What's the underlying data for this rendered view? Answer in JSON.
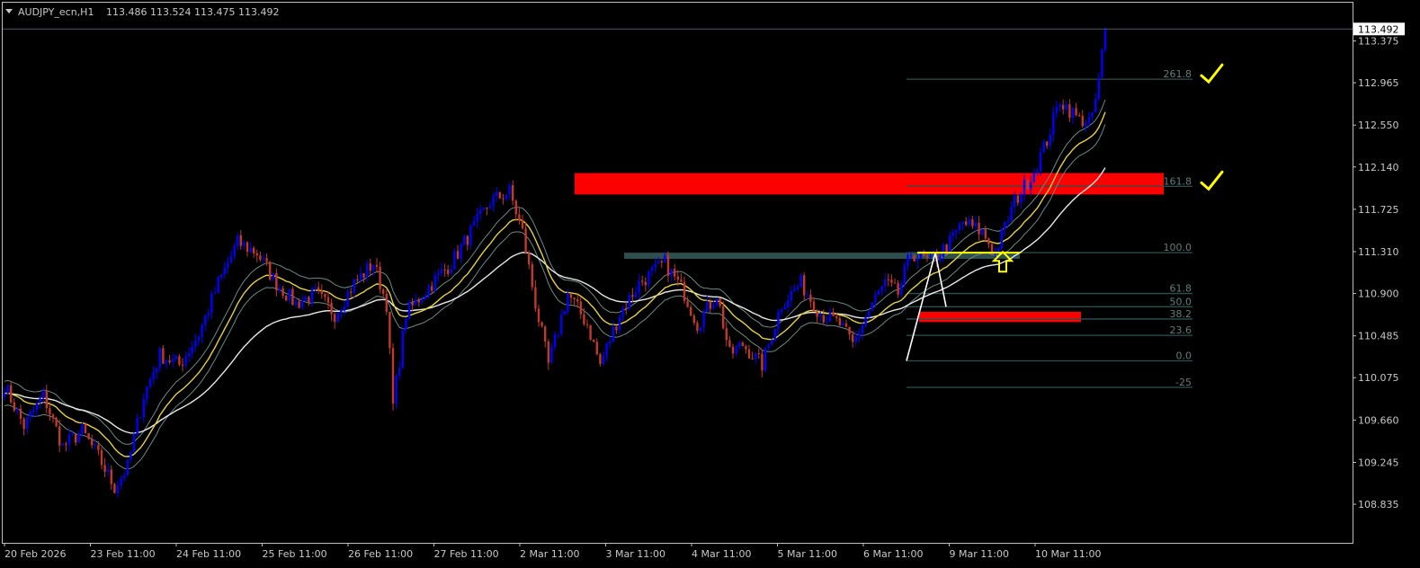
{
  "header": {
    "symbol_label": "AUDJPY_ecn,H1",
    "ohlc_text": "113.486 113.524 113.475 113.492"
  },
  "colors": {
    "background": "#000000",
    "frame": "#c0c0c0",
    "bull_candle": "#0000ff",
    "bear_candle": "#c0392b",
    "ema_fast": "#e6d23c",
    "ema_slow": "#e8e8e8",
    "envelope": "#6b8a83",
    "resistance_zone": "#ff0000",
    "support_zone": "#2f4f4f",
    "fib_line": "#2f4f4f",
    "fib_text": "#607d7a",
    "annotation": "#ffff00",
    "price_line": "#4a5a6a",
    "current_price_bg": "#ffffff"
  },
  "chart_data": {
    "type": "candlestick",
    "title": "AUDJPY_ecn,H1",
    "timeframe": "H1",
    "current_price": 113.492,
    "ohlc": {
      "open": 113.486,
      "high": 113.524,
      "low": 113.475,
      "close": 113.492
    },
    "ylim": [
      108.58,
      113.6
    ],
    "y_ticks": [
      "113.375",
      "112.965",
      "112.550",
      "112.140",
      "111.725",
      "111.310",
      "110.900",
      "110.485",
      "110.075",
      "109.660",
      "109.245",
      "108.835"
    ],
    "x_ticks": [
      "20 Feb 2026",
      "23 Feb 11:00",
      "24 Feb 11:00",
      "25 Feb 11:00",
      "26 Feb 11:00",
      "27 Feb 11:00",
      "2 Mar 11:00",
      "3 Mar 11:00",
      "4 Mar 11:00",
      "5 Mar 11:00",
      "6 Mar 11:00",
      "9 Mar 11:00",
      "10 Mar 11:00"
    ],
    "price_path": [
      [
        0,
        110.0
      ],
      [
        6,
        109.6
      ],
      [
        12,
        109.9
      ],
      [
        18,
        109.4
      ],
      [
        24,
        109.55
      ],
      [
        29,
        109.3
      ],
      [
        34,
        109.0
      ],
      [
        38,
        109.2
      ],
      [
        43,
        109.9
      ],
      [
        48,
        110.3
      ],
      [
        54,
        110.2
      ],
      [
        60,
        110.5
      ],
      [
        66,
        111.0
      ],
      [
        72,
        111.4
      ],
      [
        78,
        111.3
      ],
      [
        84,
        111.0
      ],
      [
        90,
        110.8
      ],
      [
        96,
        110.9
      ],
      [
        102,
        110.7
      ],
      [
        108,
        111.0
      ],
      [
        114,
        111.2
      ],
      [
        118,
        110.8
      ],
      [
        120,
        109.8
      ],
      [
        124,
        110.7
      ],
      [
        132,
        111.0
      ],
      [
        138,
        111.2
      ],
      [
        144,
        111.5
      ],
      [
        150,
        111.8
      ],
      [
        156,
        111.9
      ],
      [
        160,
        111.5
      ],
      [
        164,
        110.8
      ],
      [
        168,
        110.2
      ],
      [
        174,
        110.9
      ],
      [
        180,
        110.6
      ],
      [
        184,
        110.2
      ],
      [
        190,
        110.7
      ],
      [
        196,
        111.0
      ],
      [
        204,
        111.2
      ],
      [
        210,
        110.9
      ],
      [
        214,
        110.6
      ],
      [
        220,
        110.9
      ],
      [
        224,
        110.3
      ],
      [
        228,
        110.4
      ],
      [
        234,
        110.2
      ],
      [
        240,
        110.8
      ],
      [
        246,
        111.0
      ],
      [
        252,
        110.7
      ],
      [
        258,
        110.6
      ],
      [
        262,
        110.4
      ],
      [
        268,
        110.8
      ],
      [
        272,
        111.0
      ],
      [
        276,
        110.9
      ],
      [
        280,
        111.3
      ],
      [
        286,
        111.2
      ],
      [
        292,
        111.4
      ],
      [
        296,
        111.6
      ],
      [
        302,
        111.5
      ],
      [
        306,
        111.3
      ],
      [
        312,
        111.8
      ],
      [
        318,
        112.1
      ],
      [
        322,
        112.4
      ],
      [
        326,
        112.8
      ],
      [
        332,
        112.6
      ],
      [
        336,
        112.6
      ],
      [
        338,
        113.0
      ],
      [
        340,
        113.49
      ]
    ],
    "resistance_zone": {
      "from": 111.87,
      "to": 112.08,
      "label": ""
    },
    "support_zone": {
      "from": 111.24,
      "to": 111.3,
      "label": ""
    },
    "demand_zone": {
      "from": 110.62,
      "to": 110.72,
      "label": ""
    },
    "fibonacci": [
      {
        "level": "261.8",
        "price": 113.0
      },
      {
        "level": "161.8",
        "price": 111.95
      },
      {
        "level": "100.0",
        "price": 111.3
      },
      {
        "level": "61.8",
        "price": 110.9
      },
      {
        "level": "50.0",
        "price": 110.77
      },
      {
        "level": "38.2",
        "price": 110.65
      },
      {
        "level": "23.6",
        "price": 110.49
      },
      {
        "level": "0.0",
        "price": 110.24
      },
      {
        "level": "-25",
        "price": 109.98
      }
    ],
    "annotations": [
      {
        "type": "check",
        "at_level": "261.8"
      },
      {
        "type": "check",
        "at_level": "161.8"
      },
      {
        "type": "arrow-up",
        "price": 111.22
      }
    ],
    "indicators": [
      "EMA (yellow)",
      "EMA (white)",
      "envelope bands"
    ],
    "grid": false
  }
}
